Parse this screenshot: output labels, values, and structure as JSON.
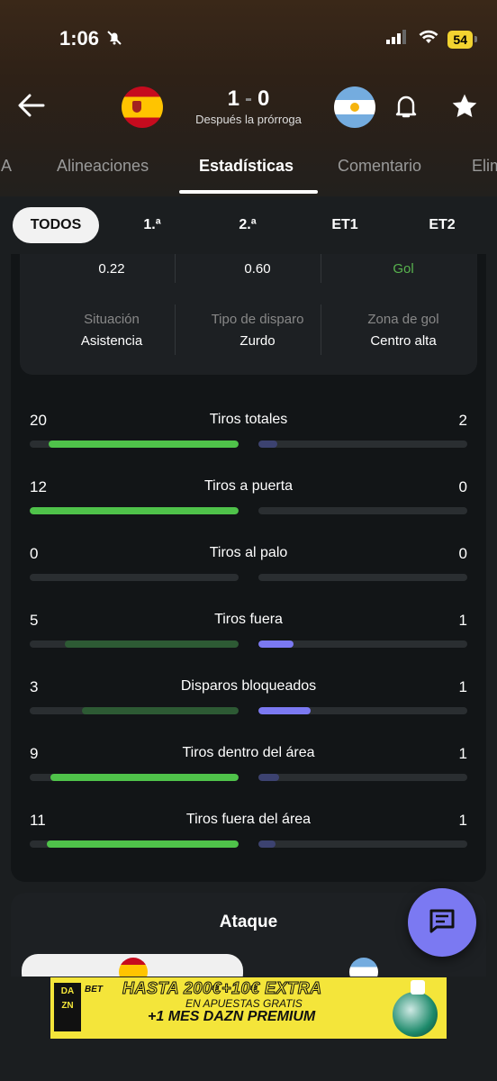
{
  "status": {
    "time": "1:06",
    "battery": "54"
  },
  "match": {
    "score_home": "1",
    "score_sep": "-",
    "score_away": "0",
    "subtitle": "Después la prórroga"
  },
  "tabs": [
    "IA",
    "Alineaciones",
    "Estadísticas",
    "Comentario",
    "Elim"
  ],
  "periods": [
    "TODOS",
    "1.ª",
    "2.ª",
    "ET1",
    "ET2"
  ],
  "shot_box": {
    "row1": [
      "0.22",
      "0.60",
      "Gol"
    ],
    "row2_labels": [
      "Situación",
      "Tipo de disparo",
      "Zona de gol"
    ],
    "row2_values": [
      "Asistencia",
      "Zurdo",
      "Centro alta"
    ]
  },
  "stats": [
    {
      "label": "Tiros totales",
      "home": "20",
      "away": "2",
      "home_fill": 0.91,
      "away_fill": 0.09
    },
    {
      "label": "Tiros a puerta",
      "home": "12",
      "away": "0",
      "home_fill": 1.0,
      "away_fill": 0.0
    },
    {
      "label": "Tiros al palo",
      "home": "0",
      "away": "0",
      "home_fill": 0.0,
      "away_fill": 0.0
    },
    {
      "label": "Tiros fuera",
      "home": "5",
      "away": "1",
      "home_fill": 0.83,
      "away_fill": 0.17
    },
    {
      "label": "Disparos bloqueados",
      "home": "3",
      "away": "1",
      "home_fill": 0.75,
      "away_fill": 0.25
    },
    {
      "label": "Tiros dentro del área",
      "home": "9",
      "away": "1",
      "home_fill": 0.9,
      "away_fill": 0.1
    },
    {
      "label": "Tiros fuera del área",
      "home": "11",
      "away": "1",
      "home_fill": 0.92,
      "away_fill": 0.08
    }
  ],
  "colors": {
    "home_bright": "#4fc24a",
    "home_dim": "#2d5a34",
    "away_bright": "#7b79f2",
    "away_dim": "#3c4270"
  },
  "attack": {
    "title": "Ataque"
  },
  "ad": {
    "logo": "DA ZN",
    "bet": "BET",
    "line1": "HASTA 200€+10€ EXTRA",
    "line2": "EN APUESTAS GRATIS",
    "line3": "+1 MES DAZN PREMIUM"
  }
}
